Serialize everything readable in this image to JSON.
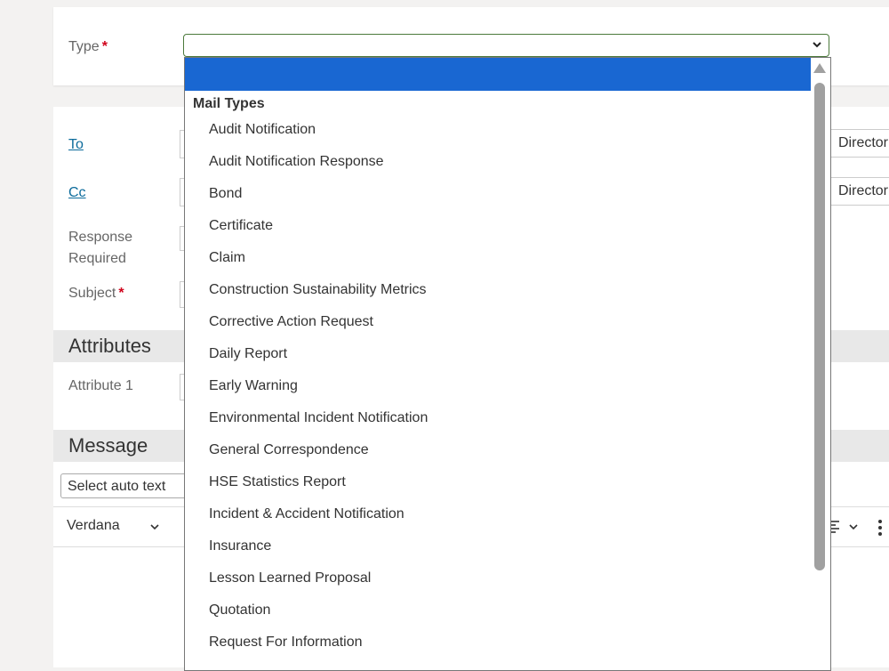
{
  "type_field": {
    "label": "Type",
    "required_mark": "*"
  },
  "form": {
    "to_label": "To",
    "cc_label": "Cc",
    "response_required_label_line1": "Response",
    "response_required_label_line2": "Required",
    "subject_label": "Subject",
    "subject_required_mark": "*",
    "to_directory": "Director",
    "cc_directory": "Director"
  },
  "attributes": {
    "title": "Attributes",
    "attribute1_label": "Attribute 1"
  },
  "message": {
    "title": "Message",
    "auto_text_placeholder": "Select auto text",
    "font": "Verdana"
  },
  "dropdown": {
    "group_label": "Mail Types",
    "options": [
      "Audit Notification",
      "Audit Notification Response",
      "Bond",
      "Certificate",
      "Claim",
      "Construction Sustainability Metrics",
      "Corrective Action Request",
      "Daily Report",
      "Early Warning",
      "Environmental Incident Notification",
      "General Correspondence",
      "HSE Statistics Report",
      "Incident & Accident Notification",
      "Insurance",
      "Lesson Learned Proposal",
      "Quotation",
      "Request For Information"
    ]
  },
  "icons": {
    "select_chevron": "chevron-down-icon",
    "list_format": "list-format-icon",
    "more": "more-vertical-icon",
    "scroll_up": "scroll-up-arrow-icon"
  },
  "colors": {
    "selected_option": "#1967d2",
    "required": "#d0021b",
    "link": "#0d6c9c",
    "select_border": "#4c7a3c"
  }
}
